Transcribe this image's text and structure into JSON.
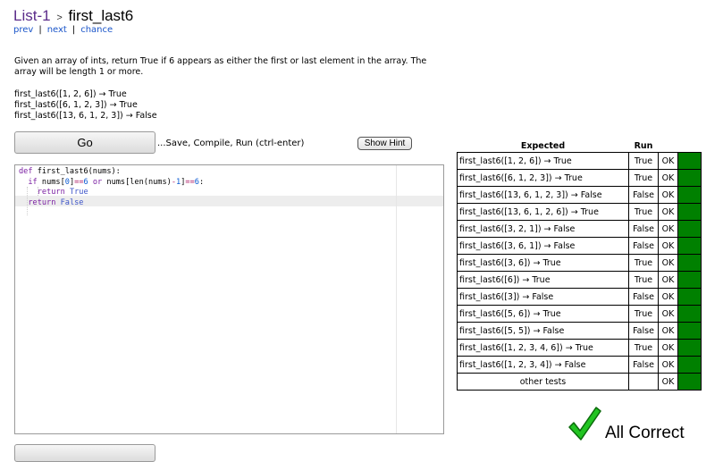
{
  "header": {
    "list_link": "List-1",
    "separator": ">",
    "title": "first_last6"
  },
  "nav": {
    "prev": "prev",
    "next": "next",
    "chance": "chance",
    "divider": "|"
  },
  "description": "Given an array of ints, return True if 6 appears as either the first or last element in the array. The array will be length 1 or more.",
  "examples": [
    "first_last6([1, 2, 6]) → True",
    "first_last6([6, 1, 2, 3]) → True",
    "first_last6([13, 6, 1, 2, 3]) → False"
  ],
  "controls": {
    "go_label": "Go",
    "go_caption": "...Save, Compile, Run (ctrl-enter)",
    "hint_label": "Show Hint"
  },
  "code": {
    "line1": {
      "kw": "def",
      "rest": " first_last6(nums):"
    },
    "line2": {
      "kw": "if",
      "a": " nums[",
      "n0": "0",
      "b": "]",
      "op1": "==",
      "n6a": "6",
      "or": " or",
      "c": " nums[len(nums)",
      "op2": "-",
      "n1": "1",
      "d": "]",
      "op3": "==",
      "n6b": "6",
      "e": ":"
    },
    "line3": {
      "kw": "return",
      "val": "True"
    },
    "line4": {
      "kw": "return",
      "val": "False"
    }
  },
  "results": {
    "headers": {
      "expected": "Expected",
      "run": "Run"
    },
    "rows": [
      {
        "expected": "first_last6([1, 2, 6]) → True",
        "run": "True",
        "status": "OK"
      },
      {
        "expected": "first_last6([6, 1, 2, 3]) → True",
        "run": "True",
        "status": "OK"
      },
      {
        "expected": "first_last6([13, 6, 1, 2, 3]) → False",
        "run": "False",
        "status": "OK"
      },
      {
        "expected": "first_last6([13, 6, 1, 2, 6]) → True",
        "run": "True",
        "status": "OK"
      },
      {
        "expected": "first_last6([3, 2, 1]) → False",
        "run": "False",
        "status": "OK"
      },
      {
        "expected": "first_last6([3, 6, 1]) → False",
        "run": "False",
        "status": "OK"
      },
      {
        "expected": "first_last6([3, 6]) → True",
        "run": "True",
        "status": "OK"
      },
      {
        "expected": "first_last6([6]) → True",
        "run": "True",
        "status": "OK"
      },
      {
        "expected": "first_last6([3]) → False",
        "run": "False",
        "status": "OK"
      },
      {
        "expected": "first_last6([5, 6]) → True",
        "run": "True",
        "status": "OK"
      },
      {
        "expected": "first_last6([5, 5]) → False",
        "run": "False",
        "status": "OK"
      },
      {
        "expected": "first_last6([1, 2, 3, 4, 6]) → True",
        "run": "True",
        "status": "OK"
      },
      {
        "expected": "first_last6([1, 2, 3, 4]) → False",
        "run": "False",
        "status": "OK"
      }
    ],
    "other_tests": {
      "label": "other tests",
      "status": "OK"
    },
    "pass_color": "#008000"
  },
  "summary": {
    "text": "All Correct",
    "icon": "checkmark-icon",
    "icon_color": "#22c422"
  }
}
